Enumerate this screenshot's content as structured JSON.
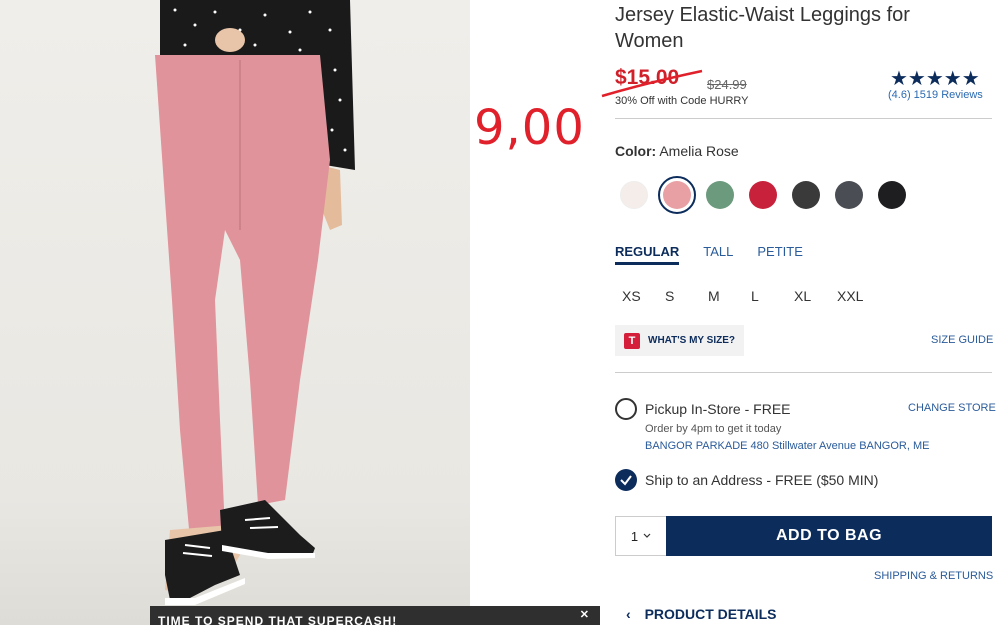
{
  "product": {
    "title": "Jersey Elastic-Waist Leggings for Women",
    "sale_price": "$15.00",
    "original_price": "$24.99",
    "promo": "30% Off with Code HURRY",
    "stars": "★★★★★",
    "rating_text": "(4.6) 1519 Reviews",
    "rating_value": 4.6
  },
  "annotation": {
    "handwritten_price": "9,00"
  },
  "color": {
    "label": "Color:",
    "selected": "Amelia Rose",
    "swatches": [
      "#f5ede9",
      "#e8a0a4",
      "#6b9a7c",
      "#c8213b",
      "#3a3a3a",
      "#4a4d54",
      "#1e1e20"
    ],
    "selected_index": 1
  },
  "fits": [
    "REGULAR",
    "TALL",
    "PETITE"
  ],
  "sizes": [
    "XS",
    "S",
    "M",
    "L",
    "XL",
    "XXL"
  ],
  "size_help": {
    "whats_my_size": "WHAT'S MY SIZE?",
    "t_icon": "T",
    "size_guide": "SIZE GUIDE"
  },
  "fulfillment": {
    "pickup_label": "Pickup In-Store - FREE",
    "change_store": "CHANGE STORE",
    "order_by": "Order by 4pm to get it today",
    "store_address": "BANGOR PARKADE 480 Stillwater Avenue  BANGOR, ME",
    "ship_label": "Ship to an Address - FREE ($50 MIN)"
  },
  "cart": {
    "quantity": "1",
    "add_to_bag": "ADD TO BAG",
    "shipping_returns": "SHIPPING & RETURNS"
  },
  "product_details": "PRODUCT DETAILS",
  "promo_bar": {
    "text": "TIME TO SPEND THAT SUPERCASH!",
    "close": "✕"
  },
  "colors": {
    "navy": "#0c2c5c",
    "sale_red": "#d0202a",
    "link_blue": "#2a5b9a"
  }
}
